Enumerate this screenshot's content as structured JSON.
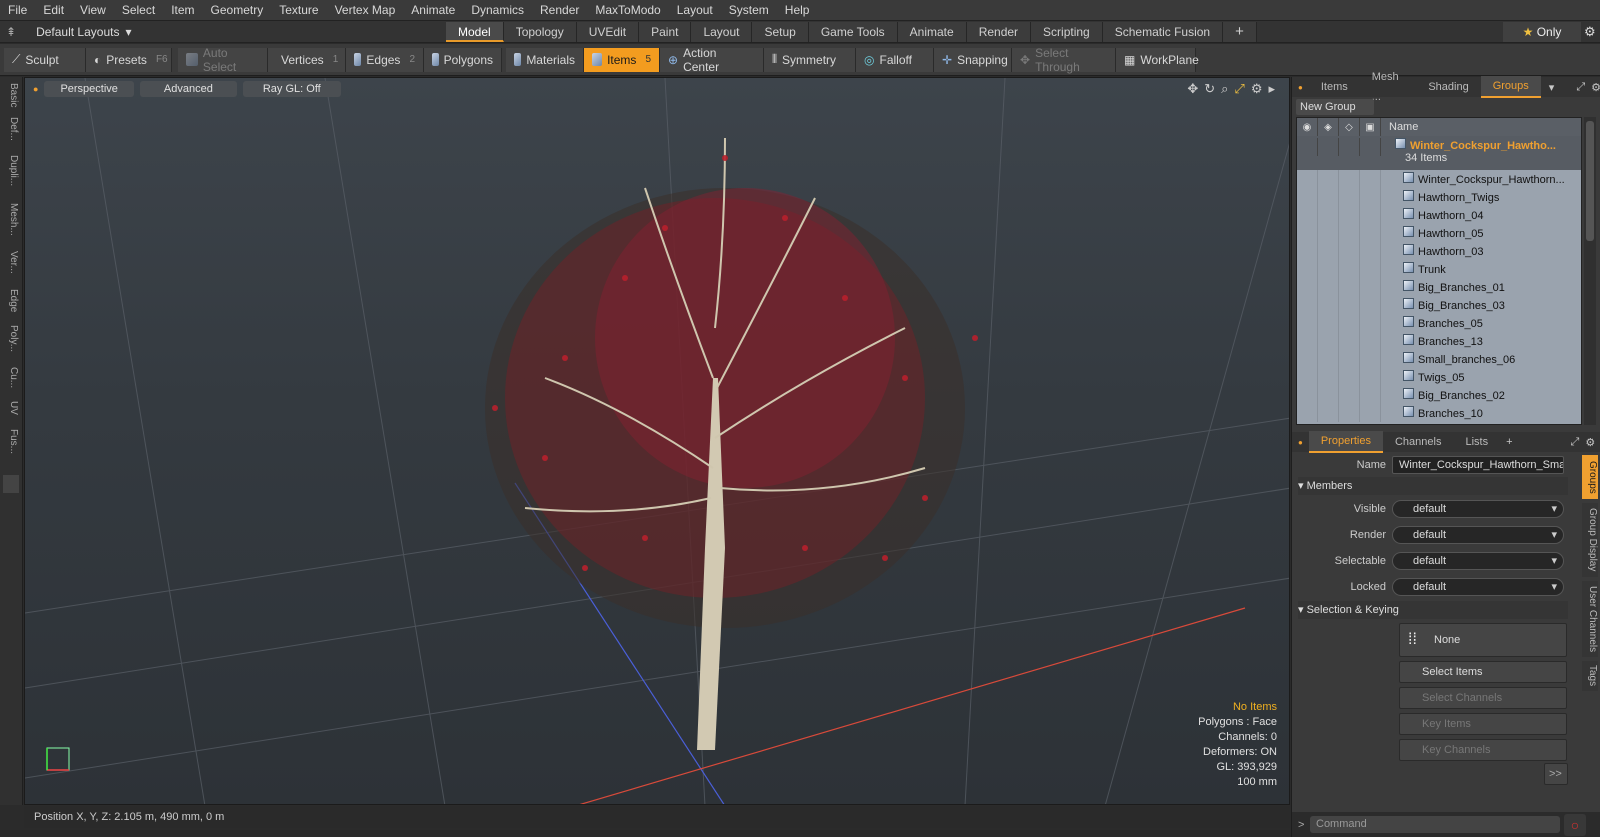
{
  "menu": [
    "File",
    "Edit",
    "View",
    "Select",
    "Item",
    "Geometry",
    "Texture",
    "Vertex Map",
    "Animate",
    "Dynamics",
    "Render",
    "MaxToModo",
    "Layout",
    "System",
    "Help"
  ],
  "layout": {
    "selector": "Default Layouts",
    "tabs": [
      "Model",
      "Topology",
      "UVEdit",
      "Paint",
      "Layout",
      "Setup",
      "Game Tools",
      "Animate",
      "Render",
      "Scripting",
      "Schematic Fusion"
    ],
    "active_tab": "Model",
    "only_label": "Only"
  },
  "toolbar": {
    "sculpt": "Sculpt",
    "presets": "Presets",
    "presets_key": "F6",
    "auto_select": "Auto Select",
    "vertices": "Vertices",
    "vertices_key": "1",
    "edges": "Edges",
    "edges_key": "2",
    "polygons": "Polygons",
    "materials": "Materials",
    "items": "Items",
    "items_key": "5",
    "action_center": "Action Center",
    "symmetry": "Symmetry",
    "falloff": "Falloff",
    "snapping": "Snapping",
    "select_through": "Select Through",
    "workplane": "WorkPlane"
  },
  "left_tabs": [
    "Basic",
    "Def...",
    "Dupli...",
    "Mesh...",
    "Ver...",
    "Edge",
    "Poly...",
    "Cu...",
    "UV",
    "Fus..."
  ],
  "viewport": {
    "view": "Perspective",
    "mode": "Advanced",
    "raygl": "Ray GL: Off",
    "hud": {
      "selection": "No Items",
      "polygons": "Polygons : Face",
      "channels": "Channels: 0",
      "deformers": "Deformers: ON",
      "gl": "GL: 393,929",
      "scale": "100 mm"
    }
  },
  "status": {
    "position": "Position X, Y, Z:  2.105 m, 490 mm, 0 m"
  },
  "right_panel": {
    "tabs": [
      "Items",
      "Mesh ...",
      "Shading",
      "Groups"
    ],
    "active_tab": "Groups",
    "new_group": "New Group",
    "list_header": "Name",
    "group": {
      "name": "Winter_Cockspur_Hawtho...",
      "count": "34 Items"
    },
    "items": [
      "Winter_Cockspur_Hawthorn...",
      "Hawthorn_Twigs",
      "Hawthorn_04",
      "Hawthorn_05",
      "Hawthorn_03",
      "Trunk",
      "Big_Branches_01",
      "Big_Branches_03",
      "Branches_05",
      "Branches_13",
      "Small_branches_06",
      "Twigs_05",
      "Big_Branches_02",
      "Branches_10"
    ],
    "prop_tabs": [
      "Properties",
      "Channels",
      "Lists"
    ],
    "active_prop_tab": "Properties",
    "props": {
      "name_label": "Name",
      "name_value": "Winter_Cockspur_Hawthorn_Sma",
      "members": "Members",
      "visible_label": "Visible",
      "visible_value": "default",
      "render_label": "Render",
      "render_value": "default",
      "selectable_label": "Selectable",
      "selectable_value": "default",
      "locked_label": "Locked",
      "locked_value": "default",
      "sel_keying": "Selection & Keying",
      "none": "None",
      "select_items": "Select Items",
      "select_channels": "Select Channels",
      "key_items": "Key Items",
      "key_channels": "Key Channels",
      "more": ">>"
    },
    "side_tabs": [
      "Groups",
      "Group Display",
      "User Channels",
      "Tags"
    ],
    "command_placeholder": "Command"
  }
}
